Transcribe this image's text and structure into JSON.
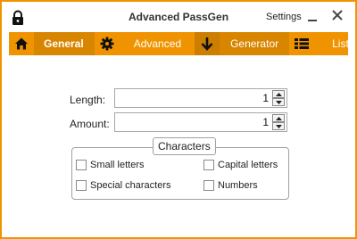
{
  "window": {
    "title": "Advanced PassGen",
    "settings_label": "Settings",
    "accent_color": "#ef9400"
  },
  "nav": {
    "tabs": [
      {
        "label": "General",
        "icon": "home-icon",
        "active": true
      },
      {
        "label": "Advanced",
        "icon": "gear-icon",
        "active": false
      },
      {
        "label": "Generator",
        "icon": "arrow-down-icon",
        "active": false
      },
      {
        "label": "List",
        "icon": "list-icon",
        "active": false
      }
    ],
    "more_icon": "caret-down-icon"
  },
  "form": {
    "length_label": "Length:",
    "length_value": "1",
    "amount_label": "Amount:",
    "amount_value": "1"
  },
  "characters": {
    "group_title": "Characters",
    "options": [
      {
        "label": "Small letters",
        "checked": false
      },
      {
        "label": "Capital letters",
        "checked": false
      },
      {
        "label": "Special characters",
        "checked": false
      },
      {
        "label": "Numbers",
        "checked": false
      }
    ]
  }
}
